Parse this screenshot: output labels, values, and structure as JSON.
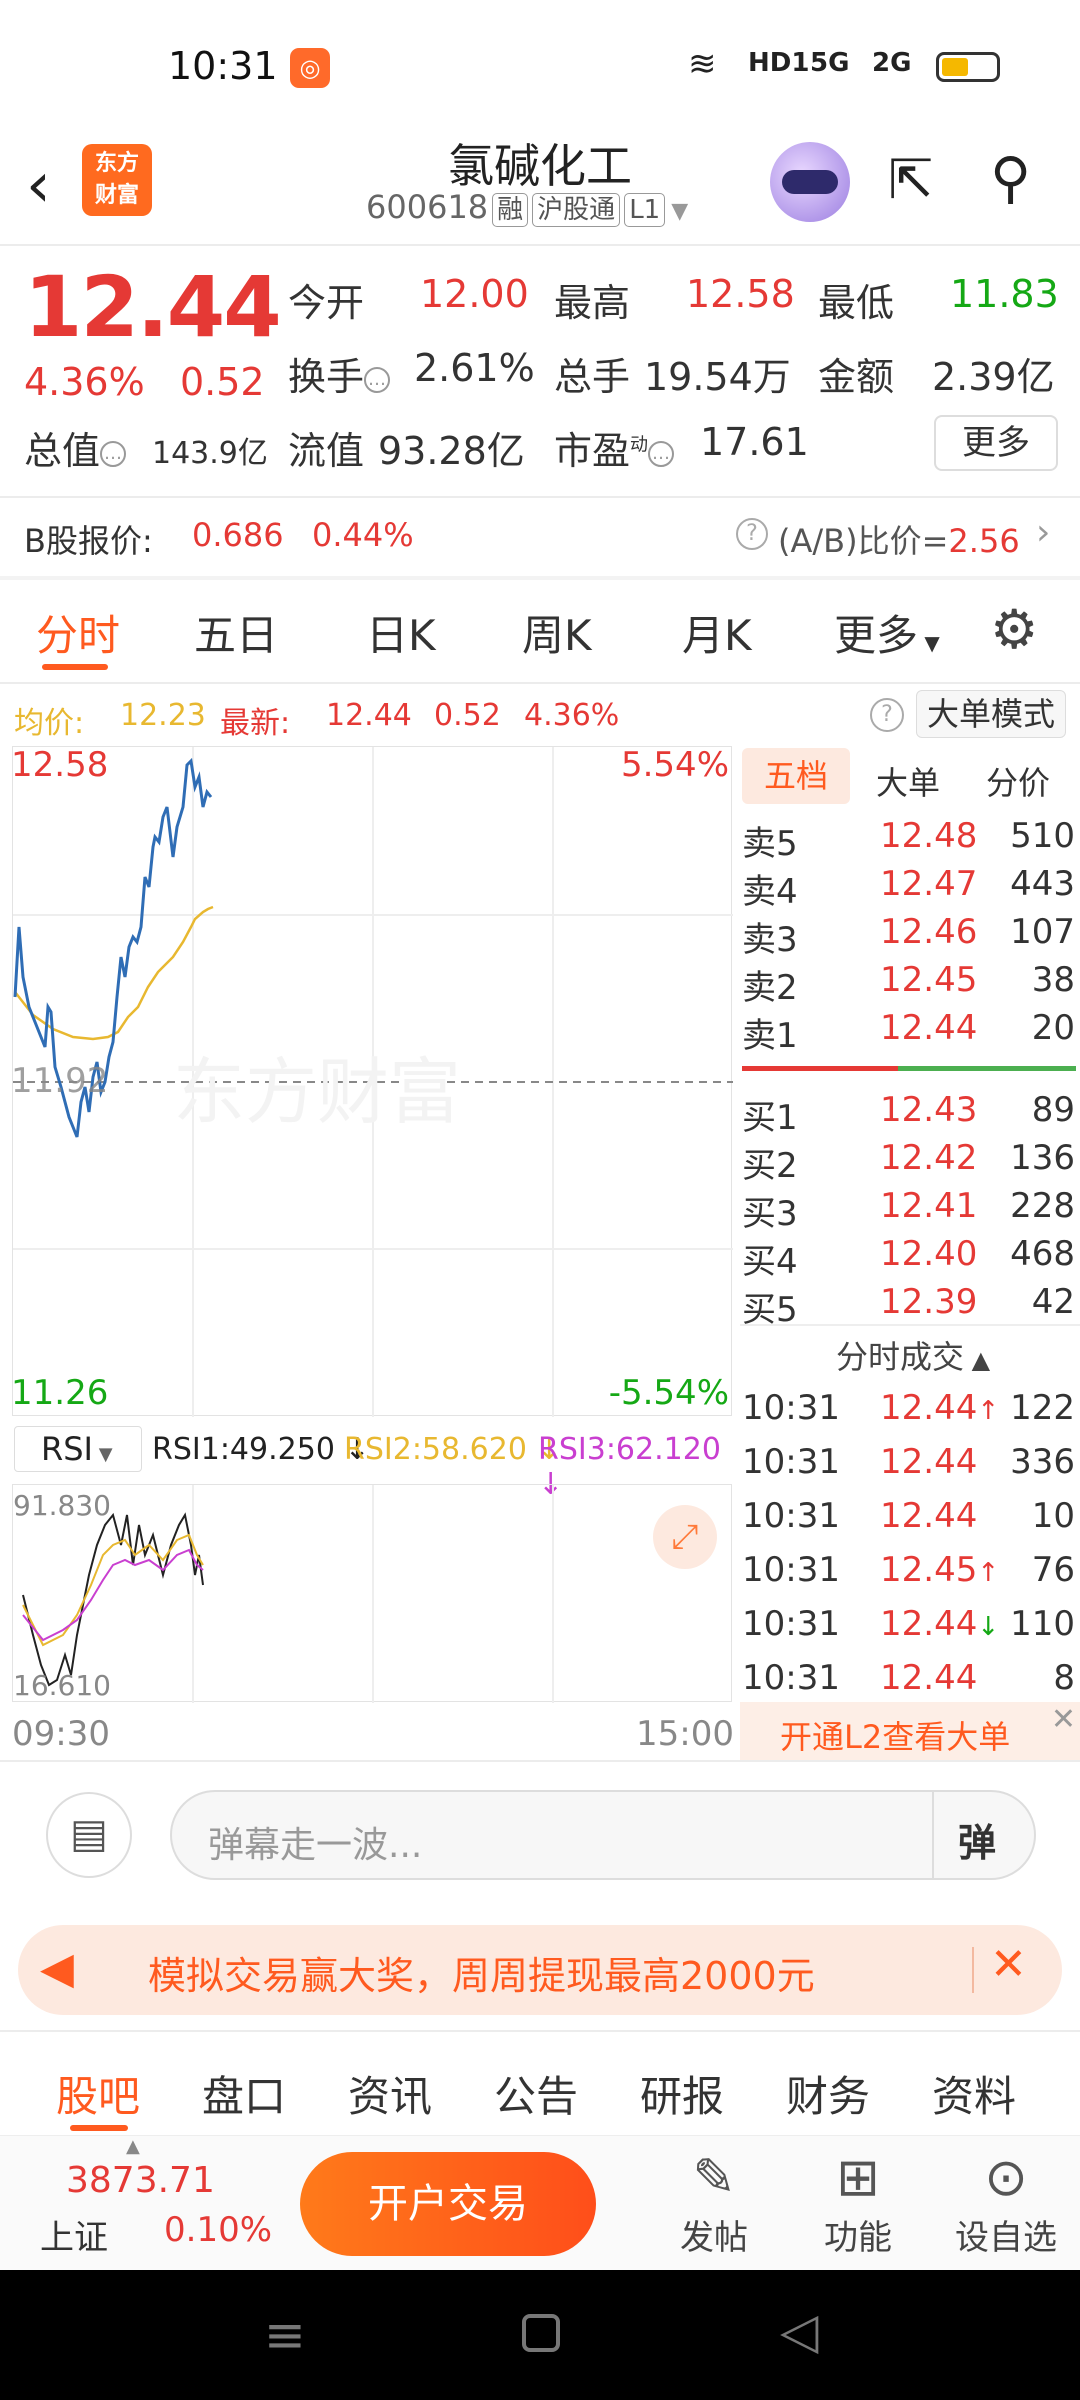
{
  "status_bar": {
    "time": "10:31",
    "indicators": [
      "HD1",
      "5G",
      "2G"
    ]
  },
  "header": {
    "logo_line1": "东方",
    "logo_line2": "财富",
    "stock_name": "氯碱化工",
    "stock_code": "600618",
    "tags": [
      "融",
      "沪股通",
      "L1"
    ]
  },
  "quote": {
    "price": "12.44",
    "change_pct": "4.36%",
    "change": "0.52",
    "open_label": "今开",
    "open": "12.00",
    "high_label": "最高",
    "high": "12.58",
    "low_label": "最低",
    "low": "11.83",
    "turnover_label": "换手",
    "turnover": "2.61%",
    "volume_label": "总手",
    "volume": "19.54万",
    "amount_label": "金额",
    "amount": "2.39亿",
    "mktcap_label": "总值",
    "mktcap": "143.9亿",
    "float_label": "流值",
    "float_cap": "93.28亿",
    "pe_label": "市盈",
    "pe_sup": "动",
    "pe": "17.61",
    "more": "更多"
  },
  "b_share": {
    "label": "B股报价:",
    "price": "0.686",
    "pct": "0.44%",
    "ratio_label": "(A/B)比价=",
    "ratio": "2.56"
  },
  "tabs": [
    "分时",
    "五日",
    "日K",
    "周K",
    "月K",
    "更多"
  ],
  "avg_bar": {
    "avg_label": "均价:",
    "avg": "12.23",
    "latest_label": "最新:",
    "latest": "12.44",
    "change": "0.52",
    "pct": "4.36%",
    "mode_button": "大单模式"
  },
  "chart": {
    "y_high": "12.58",
    "y_high_pct": "5.54%",
    "y_low": "11.26",
    "y_low_pct": "-5.54%",
    "y_mid": "11.92",
    "watermark": "东方财富",
    "time_start": "09:30",
    "time_end": "15:00"
  },
  "book_tabs": [
    "五档",
    "大单",
    "分价"
  ],
  "asks": [
    {
      "label": "卖5",
      "price": "12.48",
      "vol": "510"
    },
    {
      "label": "卖4",
      "price": "12.47",
      "vol": "443"
    },
    {
      "label": "卖3",
      "price": "12.46",
      "vol": "107"
    },
    {
      "label": "卖2",
      "price": "12.45",
      "vol": "38"
    },
    {
      "label": "卖1",
      "price": "12.44",
      "vol": "20"
    }
  ],
  "bids": [
    {
      "label": "买1",
      "price": "12.43",
      "vol": "89"
    },
    {
      "label": "买2",
      "price": "12.42",
      "vol": "136"
    },
    {
      "label": "买3",
      "price": "12.41",
      "vol": "228"
    },
    {
      "label": "买4",
      "price": "12.40",
      "vol": "468"
    },
    {
      "label": "买5",
      "price": "12.39",
      "vol": "42"
    }
  ],
  "trades_title": "分时成交",
  "trades": [
    {
      "time": "10:31",
      "price": "12.44",
      "arrow": "↑",
      "vol": "122",
      "vol_color": "#e53935"
    },
    {
      "time": "10:31",
      "price": "12.44",
      "arrow": "",
      "vol": "336",
      "vol_color": "#e53935"
    },
    {
      "time": "10:31",
      "price": "12.44",
      "arrow": "",
      "vol": "10",
      "vol_color": "#15a815"
    },
    {
      "time": "10:31",
      "price": "12.45",
      "arrow": "↑",
      "vol": "76",
      "vol_color": "#e53935"
    },
    {
      "time": "10:31",
      "price": "12.44",
      "arrow": "↓",
      "vol": "110",
      "vol_color": "#15a815"
    },
    {
      "time": "10:31",
      "price": "12.44",
      "arrow": "",
      "vol": "8",
      "vol_color": "#e53935"
    }
  ],
  "l2_promo": "开通L2查看大单",
  "rsi": {
    "selector": "RSI",
    "rsi1": "RSI1:49.250",
    "rsi2": "RSI2:58.620",
    "rsi3": "RSI3:62.120",
    "top": "91.830",
    "bottom": "16.610"
  },
  "comment": {
    "placeholder": "弹幕走一波...",
    "danmaku_button": "弹"
  },
  "banner": {
    "text": "模拟交易赢大奖，周周提现最高2000元"
  },
  "bottom_tabs": [
    "股吧",
    "盘口",
    "资讯",
    "公告",
    "研报",
    "财务",
    "资料"
  ],
  "action_bar": {
    "index_value": "3873.71",
    "index_name": "上证",
    "index_pct": "0.10%",
    "trade_button": "开户交易",
    "post": "发帖",
    "function": "功能",
    "watchlist": "设自选"
  },
  "colors": {
    "up": "#e53935",
    "down": "#15a815",
    "accent": "#ff5a1f",
    "price_line": "#2f6db5",
    "avg_line": "#e8b830"
  }
}
